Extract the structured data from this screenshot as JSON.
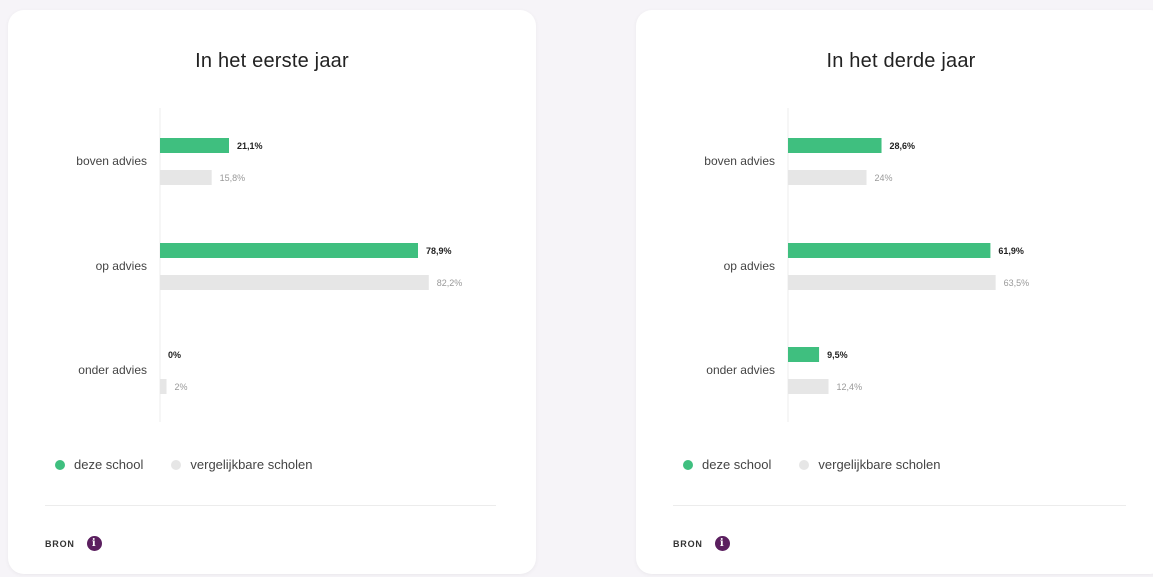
{
  "colors": {
    "school": "#3fbf7f",
    "comparable": "#e6e6e6",
    "accent": "#5b1f5f"
  },
  "legend": {
    "school": "deze school",
    "comparable": "vergelijkbare scholen"
  },
  "source_label": "BRON",
  "info_icon": "info-icon",
  "chart_data": [
    {
      "type": "bar",
      "orientation": "horizontal",
      "title": "In het eerste jaar",
      "categories": [
        "boven advies",
        "op advies",
        "onder advies"
      ],
      "series": [
        {
          "name": "deze school",
          "values": [
            21.1,
            78.9,
            0
          ],
          "labels": [
            "21,1%",
            "78,9%",
            "0%"
          ]
        },
        {
          "name": "vergelijkbare scholen",
          "values": [
            15.8,
            82.2,
            2
          ],
          "labels": [
            "15,8%",
            "82,2%",
            "2%"
          ]
        }
      ],
      "xlim": [
        0,
        100
      ],
      "grid": false,
      "legend": "bottom-left"
    },
    {
      "type": "bar",
      "orientation": "horizontal",
      "title": "In het derde jaar",
      "categories": [
        "boven advies",
        "op advies",
        "onder advies"
      ],
      "series": [
        {
          "name": "deze school",
          "values": [
            28.6,
            61.9,
            9.5
          ],
          "labels": [
            "28,6%",
            "61,9%",
            "9,5%"
          ]
        },
        {
          "name": "vergelijkbare scholen",
          "values": [
            24,
            63.5,
            12.4
          ],
          "labels": [
            "24%",
            "63,5%",
            "12,4%"
          ]
        }
      ],
      "xlim": [
        0,
        100
      ],
      "grid": false,
      "legend": "bottom-left"
    }
  ]
}
